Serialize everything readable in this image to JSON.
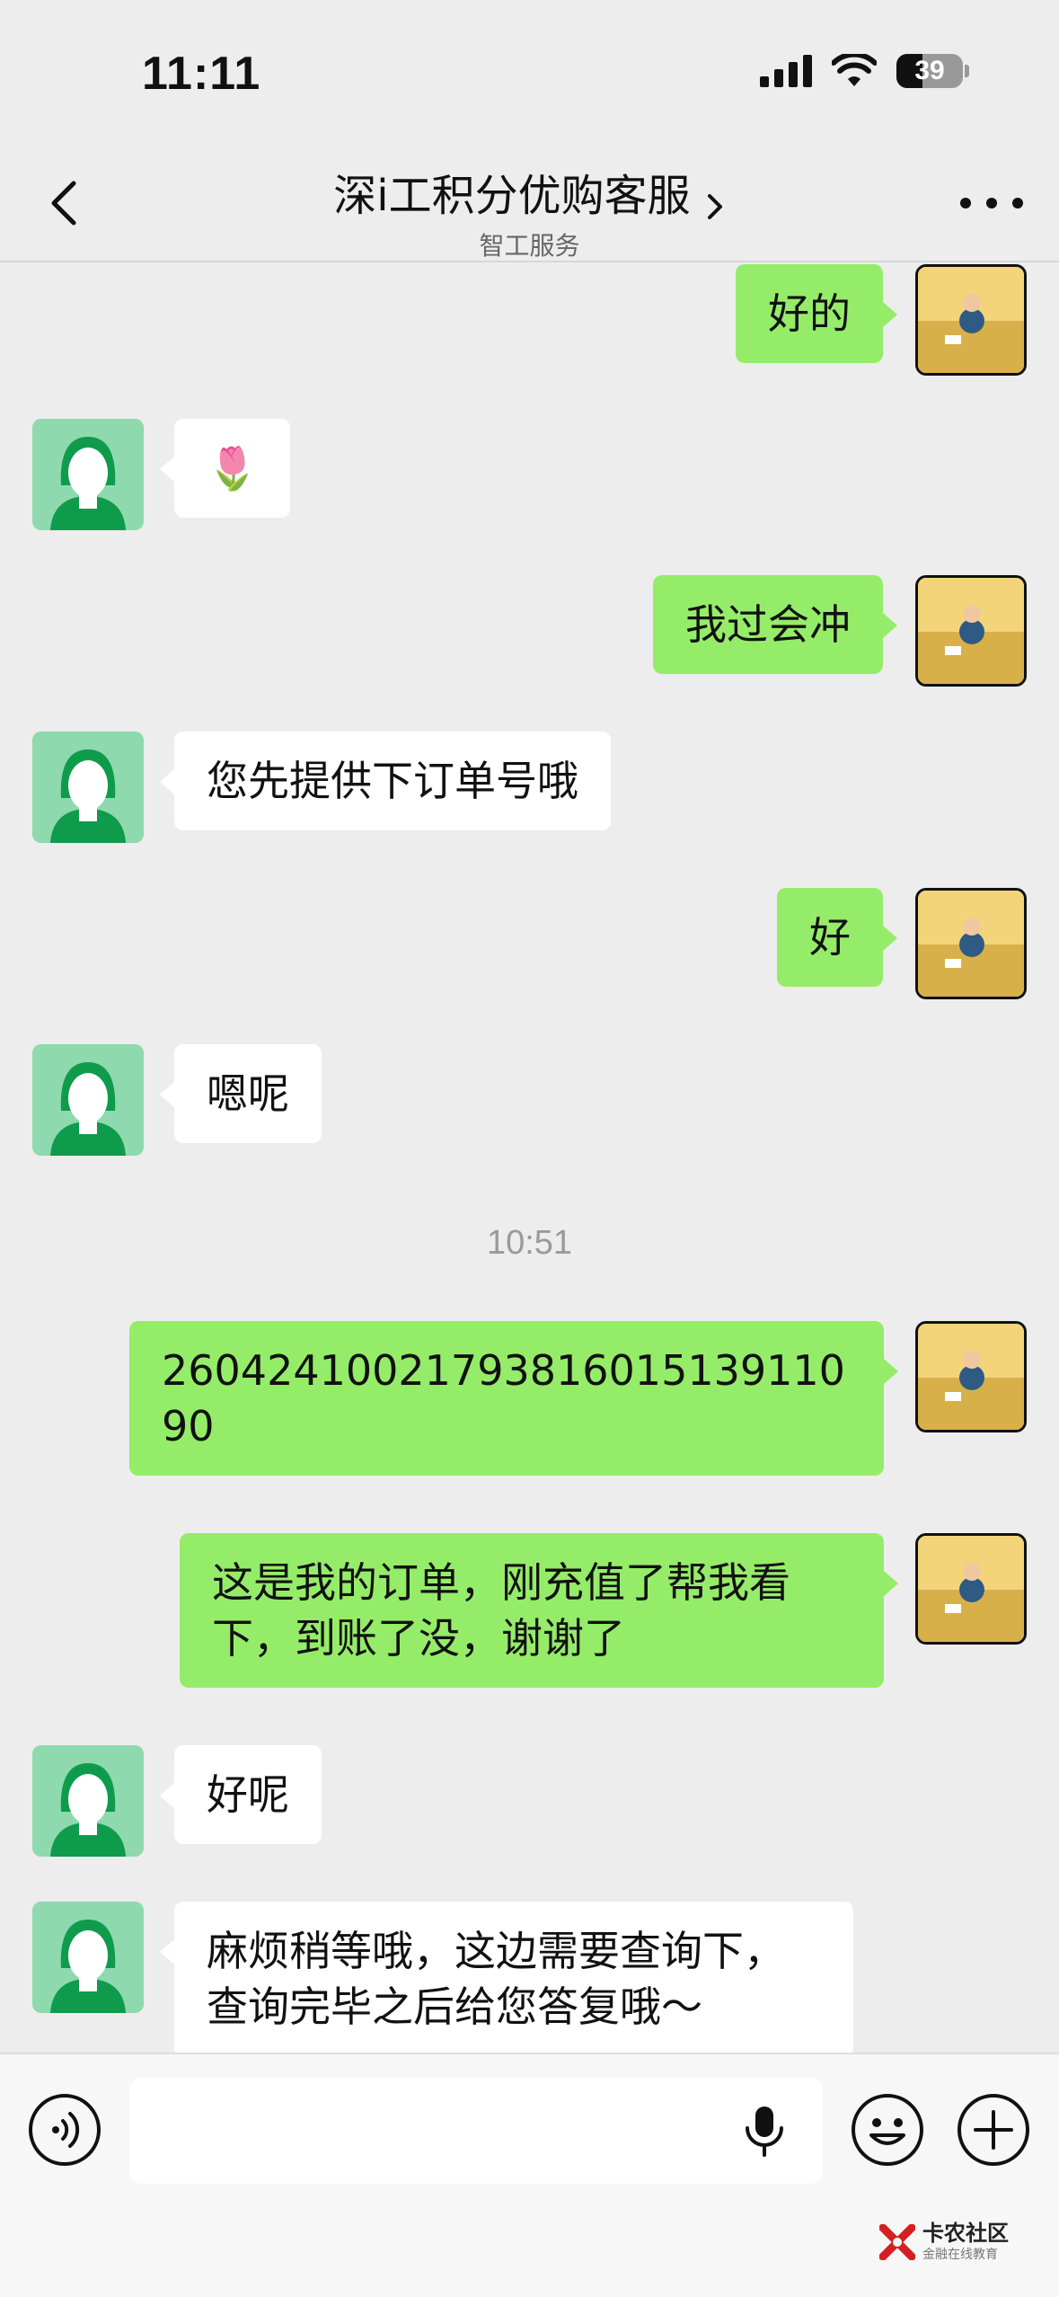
{
  "status_bar": {
    "time": "11:11",
    "battery": "39"
  },
  "nav": {
    "title": "深i工积分优购客服",
    "subtitle": "智工服务"
  },
  "messages": [
    {
      "from": "me",
      "text": "好的"
    },
    {
      "from": "cs",
      "text": "🌷"
    },
    {
      "from": "me",
      "text": "我过会冲"
    },
    {
      "from": "cs",
      "text": "您先提供下订单号哦"
    },
    {
      "from": "me",
      "text": "好"
    },
    {
      "from": "cs",
      "text": "嗯呢"
    },
    {
      "timestamp": "10:51"
    },
    {
      "from": "me",
      "text": "2604241002179381601513911090"
    },
    {
      "from": "me",
      "text": "这是我的订单，刚充值了帮我看下，到账了没，谢谢了"
    },
    {
      "from": "cs",
      "text": "好呢"
    },
    {
      "from": "cs",
      "text": "麻烦稍等哦，这边需要查询下，查询完毕之后给您答复哦～"
    }
  ],
  "input": {
    "placeholder": ""
  },
  "watermark": {
    "title": "卡农社区",
    "subtitle": "金融在线教育"
  },
  "icons": [
    "back-icon",
    "more-icon",
    "voice-icon",
    "mic-icon",
    "emoji-icon",
    "plus-icon"
  ]
}
